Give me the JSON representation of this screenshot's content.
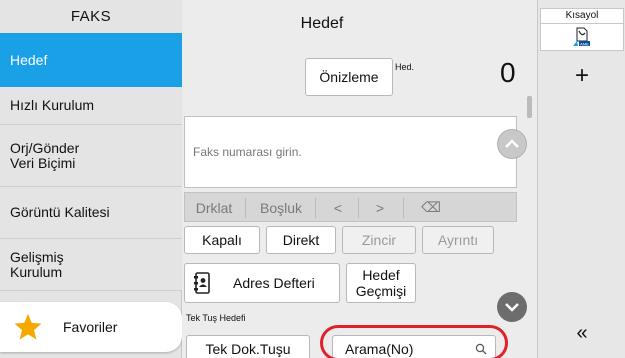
{
  "sidebar": {
    "header": "FAKS",
    "items": [
      {
        "label": "Hedef",
        "active": true
      },
      {
        "label": "Hızlı Kurulum"
      },
      {
        "label": "Orj/Gönder Veri Biçimi"
      },
      {
        "label": "Görüntü Kalitesi"
      },
      {
        "label": "Gelişmiş Kurulum"
      }
    ],
    "favorites_label": "Favoriler"
  },
  "main": {
    "title": "Hedef",
    "preview_label": "Önizleme",
    "dest_label": "Hed.",
    "dest_count": "0",
    "fax_placeholder": "Faks numarası girin.",
    "keys": {
      "pause": "Drklat",
      "space": "Boşluk",
      "left": "<",
      "right": ">",
      "backspace": "⌫"
    },
    "line_options": {
      "off": "Kapalı",
      "direct": "Direkt",
      "chain": "Zincir",
      "detail": "Ayrıntı"
    },
    "address_book_label": "Adres Defteri",
    "history_label": "Hedef Geçmişi",
    "one_touch_label": "Tek Tuş Hedefi",
    "one_touch_key_label": "Tek Dok.Tuşu",
    "search_label": "Arama(No)"
  },
  "right_panel": {
    "shortcut_label": "Kısayol",
    "shortcut_icon_text": "AME",
    "add_label": "+",
    "collapse_label": "«"
  },
  "colors": {
    "accent": "#1aa0e6",
    "highlight": "#e0202a",
    "star": "#f6a800"
  }
}
